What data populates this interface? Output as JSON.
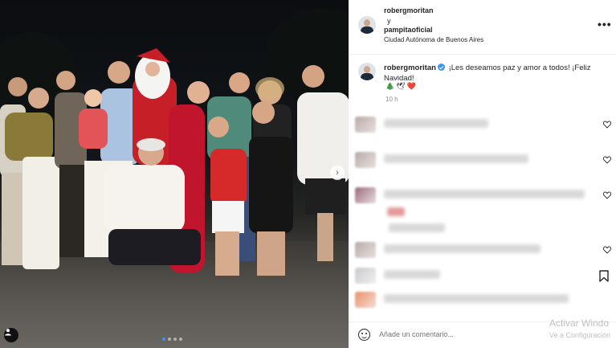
{
  "post": {
    "header": {
      "user_1": "robergmoritan",
      "connector": "y",
      "user_2": "pampitaoficial",
      "location": "Ciudad Autónoma de Buenos Aires",
      "more_icon": "ellipsis-icon"
    },
    "caption": {
      "username": "robergmoritan",
      "text": "¡Les deseamos paz y amor a todos! ¡Feliz Navidad!",
      "emojis": [
        "🎄",
        "🕊",
        "❤️"
      ],
      "time_ago": "10 h"
    },
    "photo": {
      "carousel_dots": 4,
      "active_dot": 0,
      "next_icon": "chevron-right-icon",
      "tag_icon": "user-tag-icon"
    },
    "comments": [
      {
        "blurred": true
      },
      {
        "blurred": true
      },
      {
        "blurred": true
      },
      {
        "blurred": true
      },
      {
        "blurred": true
      }
    ],
    "footer": {
      "placeholder": "Añade un comentario..."
    }
  },
  "os_watermark": {
    "line_1": "Activar Windo",
    "line_2": "Ve a Configuración"
  },
  "colors": {
    "accent_blue": "#3897f0",
    "heart_red": "#ed4956",
    "text_primary": "#262626",
    "text_secondary": "#8e8e8e"
  }
}
